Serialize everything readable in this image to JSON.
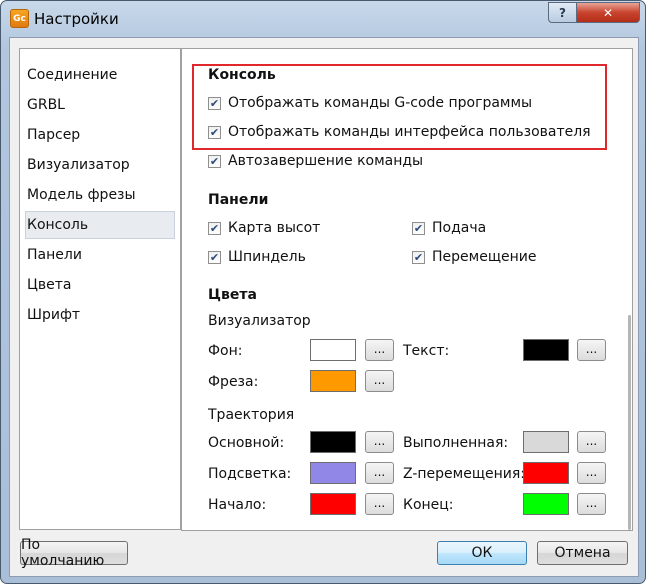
{
  "window": {
    "title": "Настройки",
    "app_icon_text": "Gc"
  },
  "titlebar": {
    "help_glyph": "?",
    "close_glyph": "✕"
  },
  "nav": {
    "items": [
      {
        "label": "Соединение"
      },
      {
        "label": "GRBL"
      },
      {
        "label": "Парсер"
      },
      {
        "label": "Визуализатор"
      },
      {
        "label": "Модель фрезы"
      },
      {
        "label": "Консоль",
        "selected": true
      },
      {
        "label": "Панели"
      },
      {
        "label": "Цвета"
      },
      {
        "label": "Шрифт"
      }
    ]
  },
  "console": {
    "title": "Консоль",
    "show_gcode": {
      "label": "Отображать команды G-code программы",
      "checked": true
    },
    "show_ui": {
      "label": "Отображать команды интерфейса пользователя",
      "checked": true
    },
    "autocomplete": {
      "label": "Автозавершение команды",
      "checked": true
    }
  },
  "panels": {
    "title": "Панели",
    "heightmap": {
      "label": "Карта высот",
      "checked": true
    },
    "spindle": {
      "label": "Шпиндель",
      "checked": true
    },
    "feed": {
      "label": "Подача",
      "checked": true
    },
    "jog": {
      "label": "Перемещение",
      "checked": true
    }
  },
  "colors": {
    "title": "Цвета",
    "visualizer_title": "Визуализатор",
    "background": {
      "label": "Фон:",
      "color": "#ffffff"
    },
    "text": {
      "label": "Текст:",
      "color": "#000000"
    },
    "tool": {
      "label": "Фреза:",
      "color": "#ff9900"
    },
    "toolpath_title": "Траектория",
    "normal": {
      "label": "Основной:",
      "color": "#000000"
    },
    "drawn": {
      "label": "Выполненная:",
      "color": "#d9d9d9"
    },
    "highlight": {
      "label": "Подсветка:",
      "color": "#9187e6"
    },
    "zmovement": {
      "label": "Z-перемещения:",
      "color": "#ff0000"
    },
    "start": {
      "label": "Начало:",
      "color": "#ff0000"
    },
    "end": {
      "label": "Конец:",
      "color": "#00ff00"
    },
    "pick_label": "..."
  },
  "footer": {
    "defaults_label": "По умолчанию",
    "ok_label": "ОК",
    "cancel_label": "Отмена"
  },
  "accent": {
    "highlight_border": "#e0282c"
  }
}
